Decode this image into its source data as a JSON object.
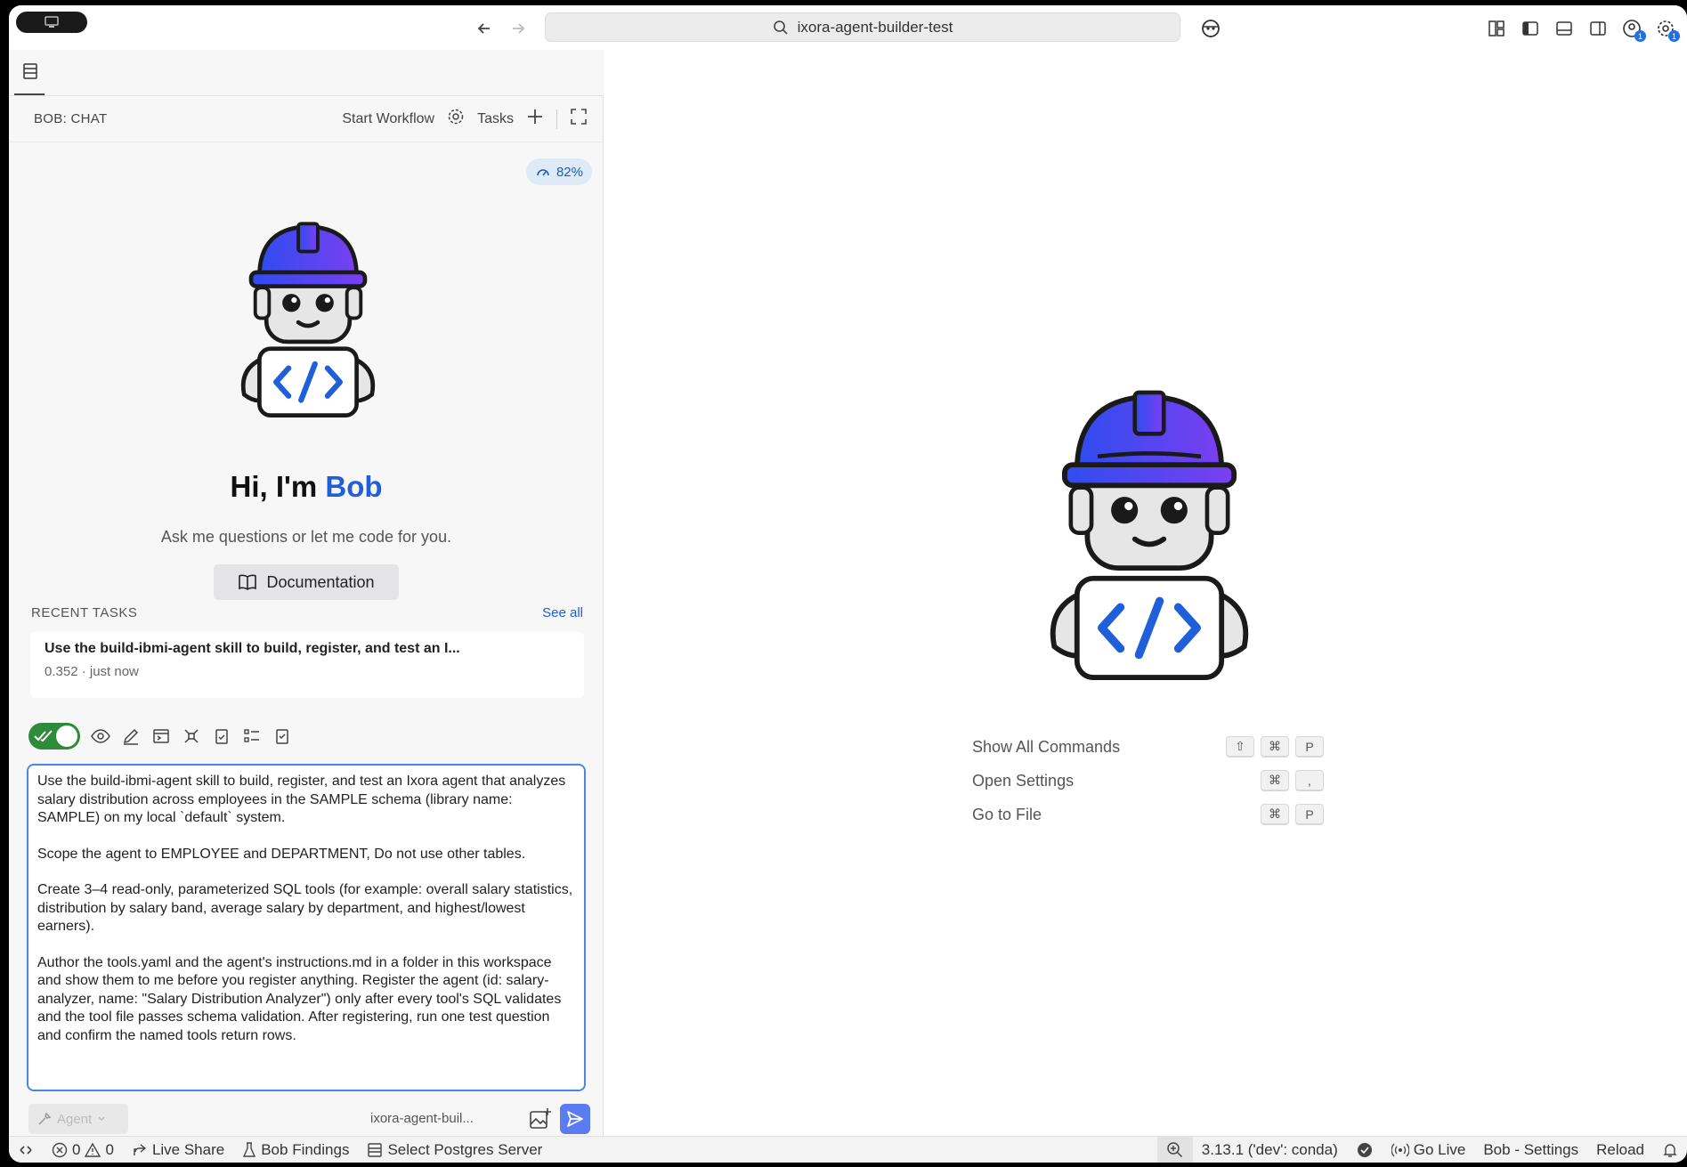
{
  "titlebar": {
    "search_text": "ixora-agent-builder-test",
    "badges": [
      "1",
      "1"
    ]
  },
  "panel": {
    "title": "BOB: CHAT",
    "start_workflow": "Start Workflow",
    "tasks": "Tasks",
    "usage": "82%"
  },
  "welcome": {
    "greeting_prefix": "Hi, I'm ",
    "greeting_name": "Bob",
    "subtitle": "Ask me questions or let me code for you.",
    "doc_button": "Documentation"
  },
  "recent": {
    "label": "RECENT TASKS",
    "see_all": "See all",
    "task_title": "Use the build-ibmi-agent skill to build, register, and test an I...",
    "task_meta": "0.352 · just now"
  },
  "prompt": {
    "paragraphs": [
      "Use the build-ibmi-agent skill to build, register, and test an Ixora agent that analyzes salary distribution across employees in the SAMPLE schema (library name: SAMPLE) on my local `default` system.",
      "Scope the agent to EMPLOYEE and DEPARTMENT, Do not use other tables.",
      "Create 3–4 read-only, parameterized SQL tools (for example: overall salary statistics, distribution by salary band, average salary by department, and highest/lowest earners).",
      "Author the tools.yaml and the agent's instructions.md in a folder in this workspace and show them to me before you register anything. Register the agent (id: salary-analyzer, name: \"Salary Distribution Analyzer\") only after every tool's SQL validates and the tool file passes schema validation. After registering, run one test question and confirm the named tools return rows."
    ]
  },
  "composer": {
    "mode": "Agent",
    "workspace": "ixora-agent-buil..."
  },
  "shortcuts": [
    {
      "label": "Show All Commands",
      "keys": [
        "⇧",
        "⌘",
        "P"
      ]
    },
    {
      "label": "Open Settings",
      "keys": [
        "⌘",
        ","
      ]
    },
    {
      "label": "Go to File",
      "keys": [
        "⌘",
        "P"
      ]
    }
  ],
  "statusbar": {
    "errors": "0",
    "warnings": "0",
    "live_share": "Live Share",
    "bob_findings": "Bob Findings",
    "postgres": "Select Postgres Server",
    "python": "3.13.1 ('dev': conda)",
    "go_live": "Go Live",
    "bob_settings": "Bob - Settings",
    "reload": "Reload"
  },
  "colors": {
    "accent": "#1f5fd9",
    "toggle_on": "#2e8b3a",
    "send_button": "#5b7bf0",
    "helmet_blue": "#2f4cf0",
    "helmet_purple": "#7a3ff0"
  }
}
